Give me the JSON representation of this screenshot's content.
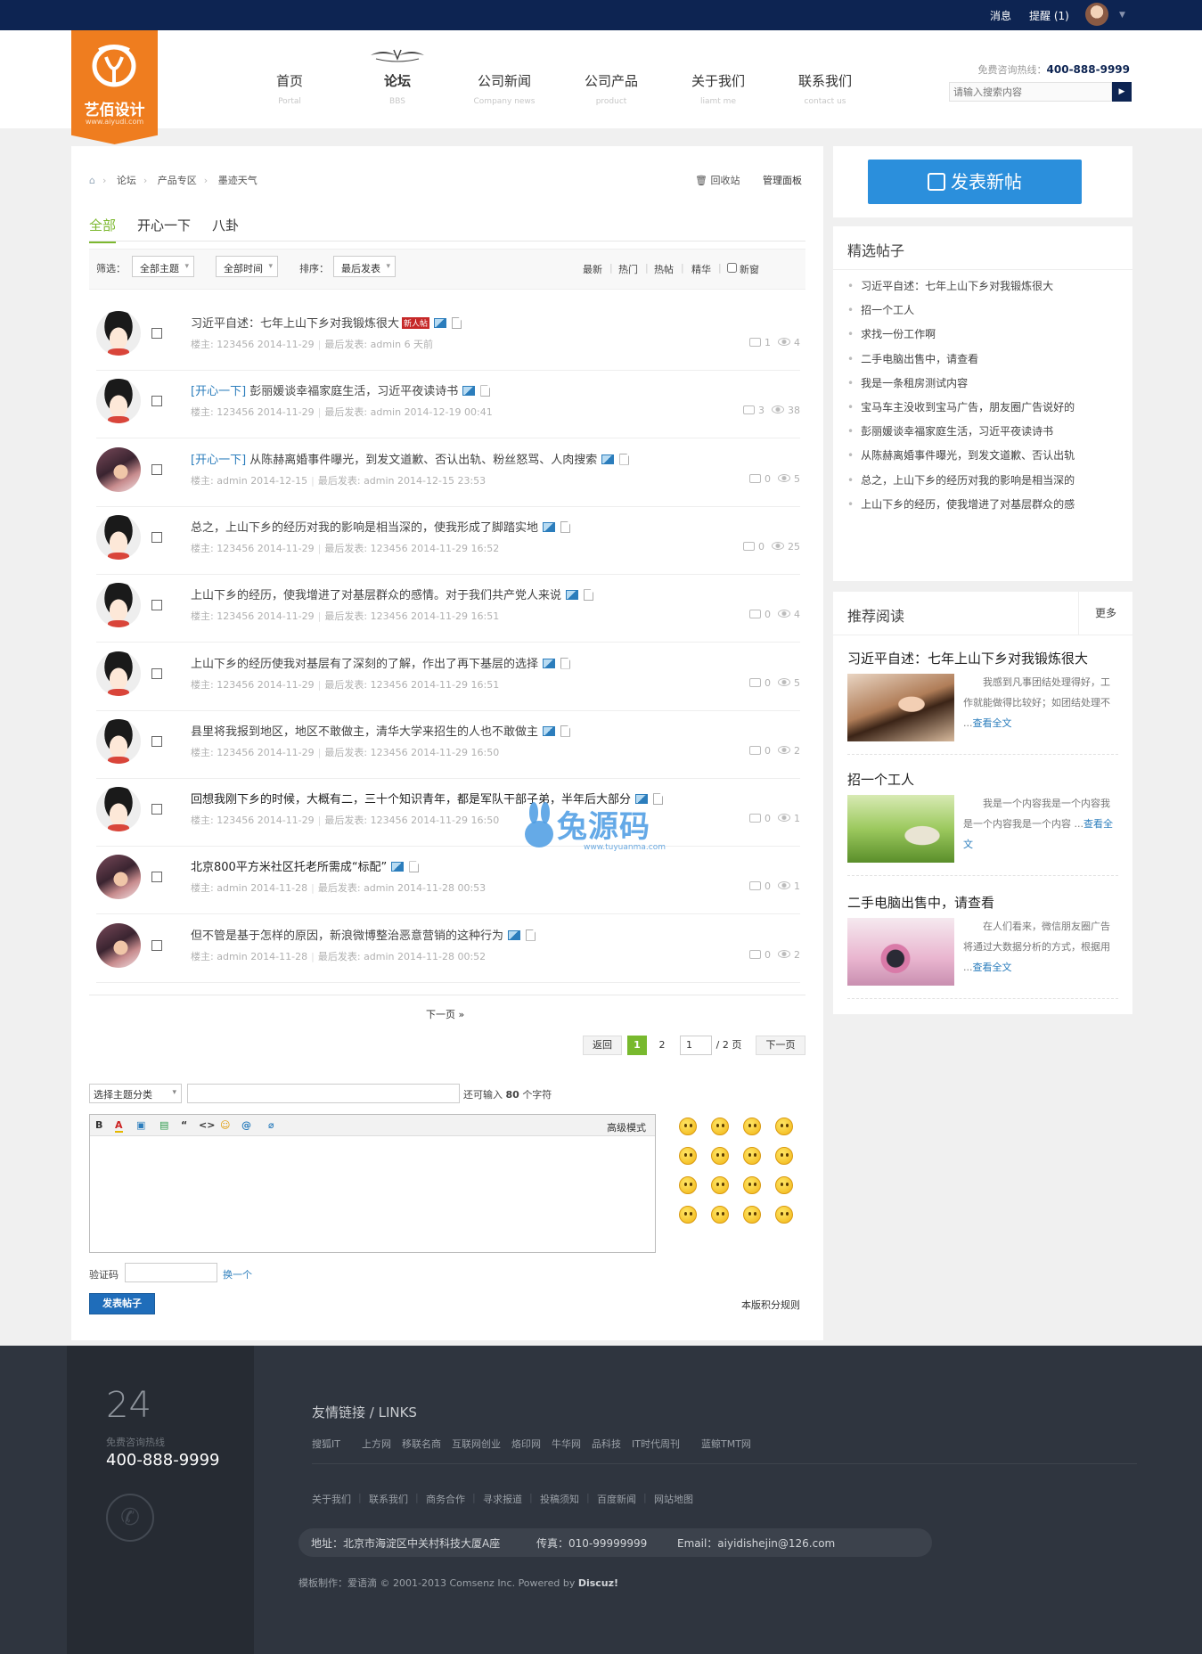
{
  "topbar": {
    "messages": "消息",
    "reminders": "提醒 (1)"
  },
  "logo": {
    "name": "艺佰设计",
    "url": "www.aiyudi.com"
  },
  "nav": [
    {
      "cn": "首页",
      "en": "Portal"
    },
    {
      "cn": "论坛",
      "en": "BBS",
      "active": true
    },
    {
      "cn": "公司新闻",
      "en": "Company news"
    },
    {
      "cn": "公司产品",
      "en": "product"
    },
    {
      "cn": "关于我们",
      "en": "liamt me"
    },
    {
      "cn": "联系我们",
      "en": "contact us"
    }
  ],
  "header": {
    "hotline_label": "免费咨询热线：",
    "hotline_number": "400-888-9999",
    "search_placeholder": "请输入搜索内容",
    "search_button": "▶"
  },
  "breadcrumb": {
    "items": [
      "论坛",
      "产品专区",
      "墨迹天气"
    ]
  },
  "toolbar": {
    "recycle": "回收站",
    "manage": "管理面板"
  },
  "tabs": [
    "全部",
    "开心一下",
    "八卦"
  ],
  "filters": {
    "filter_label": "筛选：",
    "topic": "全部主题",
    "time": "全部时间",
    "sort_label": "排序：",
    "sort": "最后发表",
    "links": [
      "最新",
      "热门",
      "热帖",
      "精华"
    ],
    "new_window": "新窗"
  },
  "threads": [
    {
      "title": "习近平自述：七年上山下乡对我锻炼很大",
      "category": "",
      "badge": "新人帖",
      "dark": false,
      "floor_label": "楼主:",
      "author": "123456",
      "date": "2014-11-29",
      "last_label": "最后发表:",
      "last": "admin",
      "last_time": "6 天前",
      "replies": "1",
      "views": "4",
      "avatar": "cartoon"
    },
    {
      "title": "彭丽媛谈幸福家庭生活，习近平夜读诗书",
      "category": "[开心一下]",
      "badge": "",
      "dark": false,
      "floor_label": "楼主:",
      "author": "123456",
      "date": "2014-11-29",
      "last_label": "最后发表:",
      "last": "admin",
      "last_time": "2014-12-19 00:41",
      "replies": "3",
      "views": "38",
      "avatar": "cartoon"
    },
    {
      "title": "从陈赫离婚事件曝光，到发文道歉、否认出轨、粉丝怒骂、人肉搜索",
      "category": "[开心一下]",
      "badge": "",
      "dark": false,
      "floor_label": "楼主:",
      "author": "admin",
      "date": "2014-12-15",
      "last_label": "最后发表:",
      "last": "admin",
      "last_time": "2014-12-15 23:53",
      "replies": "0",
      "views": "5",
      "avatar": "photo"
    },
    {
      "title": "总之，上山下乡的经历对我的影响是相当深的，使我形成了脚踏实地",
      "category": "",
      "badge": "",
      "dark": false,
      "floor_label": "楼主:",
      "author": "123456",
      "date": "2014-11-29",
      "last_label": "最后发表:",
      "last": "123456",
      "last_time": "2014-11-29 16:52",
      "replies": "0",
      "views": "25",
      "avatar": "cartoon"
    },
    {
      "title": "上山下乡的经历，使我增进了对基层群众的感情。对于我们共产党人来说",
      "category": "",
      "badge": "",
      "dark": false,
      "floor_label": "楼主:",
      "author": "123456",
      "date": "2014-11-29",
      "last_label": "最后发表:",
      "last": "123456",
      "last_time": "2014-11-29 16:51",
      "replies": "0",
      "views": "4",
      "avatar": "cartoon"
    },
    {
      "title": "上山下乡的经历使我对基层有了深刻的了解，作出了再下基层的选择",
      "category": "",
      "badge": "",
      "dark": false,
      "floor_label": "楼主:",
      "author": "123456",
      "date": "2014-11-29",
      "last_label": "最后发表:",
      "last": "123456",
      "last_time": "2014-11-29 16:51",
      "replies": "0",
      "views": "5",
      "avatar": "cartoon"
    },
    {
      "title": "县里将我报到地区，地区不敢做主，清华大学来招生的人也不敢做主",
      "category": "",
      "badge": "",
      "dark": false,
      "floor_label": "楼主:",
      "author": "123456",
      "date": "2014-11-29",
      "last_label": "最后发表:",
      "last": "123456",
      "last_time": "2014-11-29 16:50",
      "replies": "0",
      "views": "2",
      "avatar": "cartoon"
    },
    {
      "title": "回想我刚下乡的时候，大概有二，三十个知识青年，都是军队干部子弟，半年后大部分",
      "category": "",
      "badge": "",
      "dark": true,
      "floor_label": "楼主:",
      "author": "123456",
      "date": "2014-11-29",
      "last_label": "最后发表:",
      "last": "123456",
      "last_time": "2014-11-29 16:50",
      "replies": "0",
      "views": "1",
      "avatar": "cartoon"
    },
    {
      "title": "北京800平方米社区托老所需成“标配”",
      "category": "",
      "badge": "",
      "dark": true,
      "floor_label": "楼主:",
      "author": "admin",
      "date": "2014-11-28",
      "last_label": "最后发表:",
      "last": "admin",
      "last_time": "2014-11-28 00:53",
      "replies": "0",
      "views": "1",
      "avatar": "photo"
    },
    {
      "title": "但不管是基于怎样的原因，新浪微博整治恶意营销的这种行为",
      "category": "",
      "badge": "",
      "dark": false,
      "floor_label": "楼主:",
      "author": "admin",
      "date": "2014-11-28",
      "last_label": "最后发表:",
      "last": "admin",
      "last_time": "2014-11-28 00:52",
      "replies": "0",
      "views": "2",
      "avatar": "photo"
    }
  ],
  "pagination": {
    "next_link": "下一页 »",
    "back": "返回",
    "pages": [
      "1",
      "2"
    ],
    "current_input": "1",
    "total": "/ 2 页",
    "next": "下一页"
  },
  "reply": {
    "type_select": "选择主题分类",
    "char_tip_prefix": "还可输入",
    "char_count": "80",
    "char_tip_suffix": "个字符",
    "tools": [
      "B",
      "A",
      "▣",
      "▤",
      "“",
      "<>",
      "☺",
      "@",
      "⌀"
    ],
    "advanced": "高级模式",
    "captcha_label": "验证码",
    "captcha_change": "换一个",
    "submit": "发表帖子",
    "rules": "本版积分规则"
  },
  "sidebar": {
    "new_post": "发表新帖",
    "featured_title": "精选帖子",
    "featured": [
      "习近平自述：七年上山下乡对我锻炼很大",
      "招一个工人",
      "求找一份工作啊",
      "二手电脑出售中，请查看",
      "我是一条租房测试内容",
      "宝马车主没收到宝马广告，朋友圈广告说好的",
      "彭丽媛谈幸福家庭生活，习近平夜读诗书",
      "从陈赫离婚事件曝光，到发文道歉、否认出轨",
      "总之，上山下乡的经历对我的影响是相当深的",
      "上山下乡的经历，使我增进了对基层群众的感"
    ],
    "recommend_title": "推荐阅读",
    "more": "更多",
    "recommend": [
      {
        "title": "习近平自述：七年上山下乡对我锻炼很大",
        "text": "我感到凡事团结处理得好，工作就能做得比较好；如团结处理不 ...",
        "more": "查看全文"
      },
      {
        "title": "招一个工人",
        "text": "我是一个内容我是一个内容我是一个内容我是一个内容 ...",
        "more": "查看全文"
      },
      {
        "title": "二手电脑出售中，请查看",
        "text": "在人们看来，微信朋友圈广告将通过大数据分析的方式，根据用 ...",
        "more": "查看全文"
      }
    ]
  },
  "footer": {
    "num": "24",
    "hot_label": "免费咨询热线",
    "phone": "400-888-9999",
    "links_title": "友情链接 / LINKS",
    "links": [
      "搜狐IT",
      "上方网",
      "移联名商",
      "互联网创业",
      "烙印网",
      "牛华网",
      "品科技",
      "IT时代周刊",
      "蓝鲸TMT网"
    ],
    "nav": [
      "关于我们",
      "联系我们",
      "商务合作",
      "寻求报道",
      "投稿须知",
      "百度新闻",
      "网站地图"
    ],
    "address": "地址：北京市海淀区中关村科技大厦A座",
    "fax": "传真：010-99999999",
    "email": "Email：aiyidishejin@126.com",
    "copyright": "模板制作：爱语滴 © 2001-2013 Comsenz Inc. Powered by",
    "powered": "Discuz!"
  },
  "watermark": {
    "main": "兔源码",
    "sub": "www.tuyuanma.com"
  },
  "colors": {
    "topbar": "#0d2452",
    "logo": "#ef7d1f",
    "accent_green": "#7cb82f",
    "link_blue": "#2b7dbc",
    "post_button": "#2b8fdc",
    "footer": "#2f353f"
  }
}
